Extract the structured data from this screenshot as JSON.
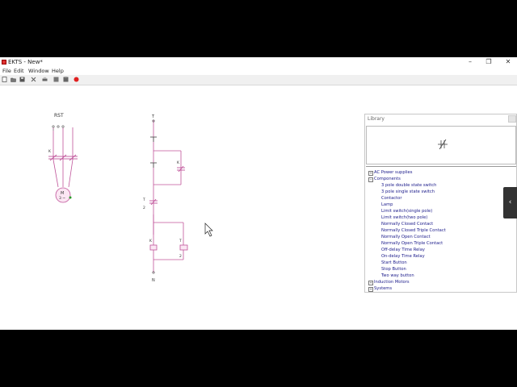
{
  "window": {
    "title": "EKTS - New*",
    "minimize": "–",
    "maximize": "❐",
    "close": "✕"
  },
  "menu": [
    "File",
    "Edit",
    "Window",
    "Help"
  ],
  "toolbar": [
    "new-icon",
    "open-icon",
    "save-icon",
    "cut-icon",
    "print-icon",
    "copy-icon",
    "paste-icon",
    "record-icon"
  ],
  "circuit": {
    "motor_phases": "RST",
    "motor_contact_label": "K",
    "motor_symbol": "M",
    "motor_phase_count": "3 ~",
    "control_top": "T",
    "control_bottom": "N",
    "contactor_label": "K",
    "timer_label": "T",
    "timer_number": "2",
    "coil_k_label": "K",
    "coil_t_label": "T",
    "coil_t_number": "2"
  },
  "library": {
    "title": "Library",
    "tree": [
      {
        "label": "AC Power supplies",
        "level": 0,
        "expander": "+"
      },
      {
        "label": "Components",
        "level": 0,
        "expander": "−"
      },
      {
        "label": "3 pole double state switch",
        "level": 1
      },
      {
        "label": "3 pole single state switch",
        "level": 1
      },
      {
        "label": "Contactor",
        "level": 1
      },
      {
        "label": "Lamp",
        "level": 1
      },
      {
        "label": "Limit switch(single pole)",
        "level": 1
      },
      {
        "label": "Limit switch(two pole)",
        "level": 1
      },
      {
        "label": "Normally Closed Contact",
        "level": 1
      },
      {
        "label": "Normally Closed Triple Contact",
        "level": 1
      },
      {
        "label": "Normally Open Contact",
        "level": 1
      },
      {
        "label": "Normally Open Triple Contact",
        "level": 1
      },
      {
        "label": "Off-delay Time Relay",
        "level": 1
      },
      {
        "label": "On-delay Time Relay",
        "level": 1
      },
      {
        "label": "Start Button",
        "level": 1
      },
      {
        "label": "Stop Button",
        "level": 1
      },
      {
        "label": "Two way button",
        "level": 1
      },
      {
        "label": "Induction Motors",
        "level": 0,
        "expander": "+"
      },
      {
        "label": "Systems",
        "level": 0,
        "expander": "+"
      }
    ]
  },
  "side_tab": "‹",
  "colors": {
    "wire": "#c0549a",
    "motor_fill": "#fbe6f3",
    "record": "#e02020",
    "terminal_green": "#2a9a2a"
  }
}
